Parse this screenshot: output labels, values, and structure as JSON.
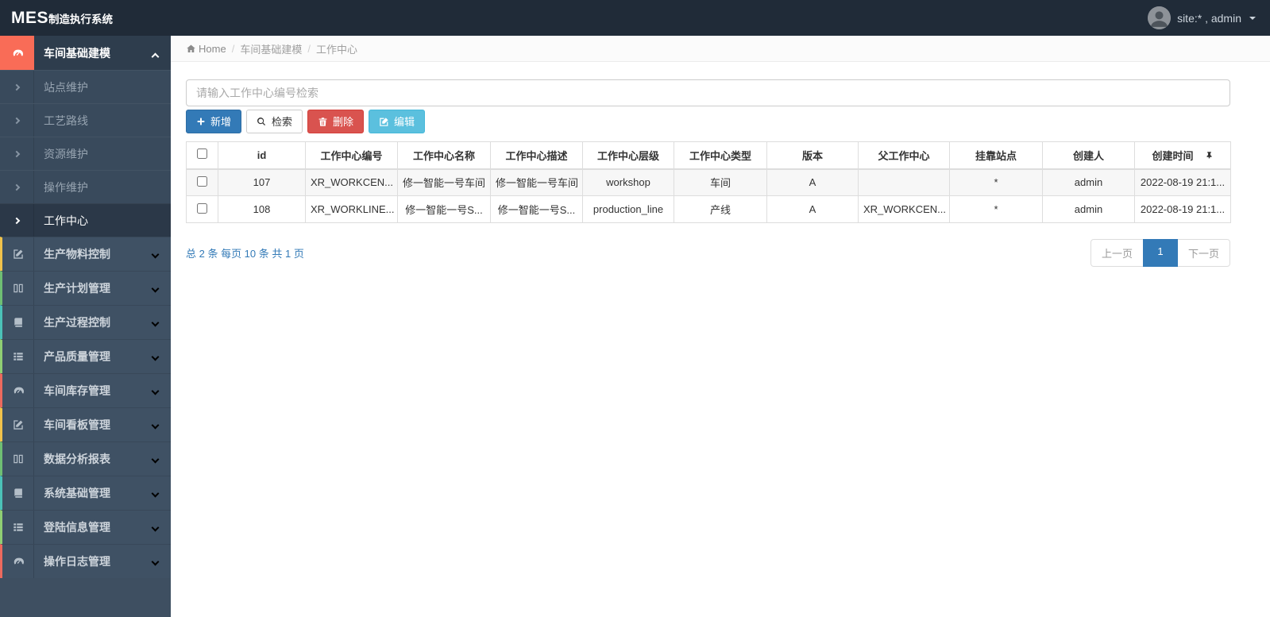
{
  "navbar": {
    "logo_bold": "MES",
    "logo_rest": "制造执行系统",
    "user_label": "site:* , admin"
  },
  "breadcrumb": {
    "home": "Home",
    "separator": "/",
    "level1": "车间基础建模",
    "level2": "工作中心"
  },
  "search": {
    "placeholder": "请输入工作中心编号检索",
    "value": ""
  },
  "toolbar": {
    "add_label": "新增",
    "search_label": "检索",
    "delete_label": "删除",
    "edit_label": "编辑"
  },
  "table": {
    "columns": [
      "id",
      "工作中心编号",
      "工作中心名称",
      "工作中心描述",
      "工作中心层级",
      "工作中心类型",
      "版本",
      "父工作中心",
      "挂靠站点",
      "创建人",
      "创建时间"
    ],
    "rows": [
      [
        "107",
        "XR_WORKCEN...",
        "修一智能一号车间",
        "修一智能一号车间",
        "workshop",
        "车间",
        "A",
        "",
        "*",
        "admin",
        "2022-08-19 21:1..."
      ],
      [
        "108",
        "XR_WORKLINE...",
        "修一智能一号S...",
        "修一智能一号S...",
        "production_line",
        "产线",
        "A",
        "XR_WORKCEN...",
        "*",
        "admin",
        "2022-08-19 21:1..."
      ]
    ]
  },
  "pagination": {
    "summary": "总 2 条  每页 10 条  共 1 页",
    "prev_label": "上一页",
    "current_page": "1",
    "next_label": "下一页"
  },
  "sidebar": {
    "active_group": {
      "label": "车间基础建模",
      "icon": "dashboard-icon",
      "children": [
        "站点维护",
        "工艺路线",
        "资源维护",
        "操作维护",
        "工作中心"
      ],
      "active_child": "工作中心"
    },
    "groups": [
      {
        "label": "生产物料控制",
        "icon": "edit-icon",
        "stripe_color": "#f0c24b"
      },
      {
        "label": "生产计划管理",
        "icon": "columns-icon",
        "stripe_color": "#6fbf73"
      },
      {
        "label": "生产过程控制",
        "icon": "book-icon",
        "stripe_color": "#4bc2b8"
      },
      {
        "label": "产品质量管理",
        "icon": "list-icon",
        "stripe_color": "#8fcf73"
      },
      {
        "label": "车间库存管理",
        "icon": "dashboard-icon",
        "stripe_color": "#ec6a5e"
      },
      {
        "label": "车间看板管理",
        "icon": "edit-icon",
        "stripe_color": "#f0c24b"
      },
      {
        "label": "数据分析报表",
        "icon": "columns-icon",
        "stripe_color": "#6fbf73"
      },
      {
        "label": "系统基础管理",
        "icon": "book-icon",
        "stripe_color": "#4bc2b8"
      },
      {
        "label": "登陆信息管理",
        "icon": "list-icon",
        "stripe_color": "#8fcf73"
      },
      {
        "label": "操作日志管理",
        "icon": "dashboard-icon",
        "stripe_color": "#ec6a5e"
      }
    ]
  },
  "colors": {
    "navbar_bg": "#202b38",
    "sidebar_bg": "#3e4f61",
    "active_icon_bg": "#f96c57",
    "accent_blue": "#337ab7",
    "danger_red": "#d9534f",
    "info_cyan": "#5bc0de",
    "pagination_active": "#337ab7"
  }
}
